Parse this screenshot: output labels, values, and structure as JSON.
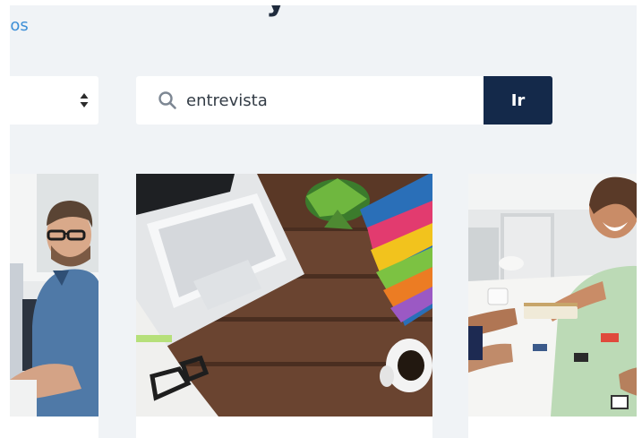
{
  "header": {
    "title_fragment": "y",
    "breadcrumb_link": "sos"
  },
  "filter": {
    "selected_value": ""
  },
  "search": {
    "value": "entrevista",
    "button_label": "Ir"
  },
  "colors": {
    "link": "#3d8fd6",
    "button": "#14294a",
    "panel_background": "#f0f3f6"
  },
  "icons": {
    "search": "search-icon",
    "select": "sort-arrows-icon"
  },
  "cards": [
    {
      "image": "man-with-glasses-at-desk-photo"
    },
    {
      "image": "laptop-on-wooden-desk-photo"
    },
    {
      "image": "woman-laughing-at-meeting-table-photo"
    }
  ]
}
